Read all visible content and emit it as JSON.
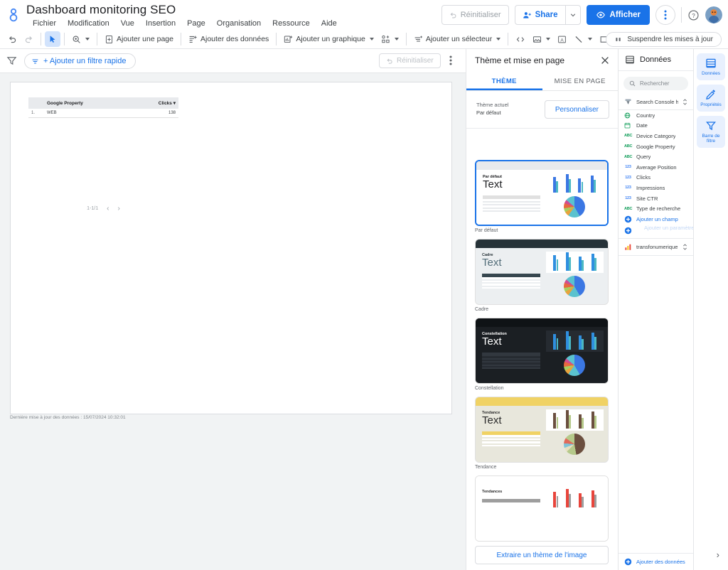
{
  "app": {
    "logo_icon": "looker-studio-logo",
    "title": "Dashboard monitoring SEO",
    "menu": [
      "Fichier",
      "Modification",
      "Vue",
      "Insertion",
      "Page",
      "Organisation",
      "Ressource",
      "Aide"
    ]
  },
  "topbar_actions": {
    "reset_label": "Réinitialiser",
    "reset_icon": "undo-icon",
    "share_label": "Share",
    "share_icon": "person-add-icon",
    "share_caret_icon": "chevron-down-icon",
    "view_label": "Afficher",
    "view_icon": "eye-icon",
    "kebab_icon": "more-vert-icon",
    "help_icon": "help-circle-icon",
    "avatar_icon": "user-avatar"
  },
  "toolbar": {
    "undo_icon": "undo-icon",
    "redo_icon": "redo-icon",
    "select_icon": "cursor-arrow-icon",
    "zoom_icon": "magnifier-icon",
    "add_page_label": "Ajouter une page",
    "add_page_icon": "page-add-icon",
    "add_data_label": "Ajouter des données",
    "add_data_icon": "data-add-icon",
    "add_chart_label": "Ajouter un graphique",
    "add_chart_icon": "chart-add-icon",
    "community_icon": "community-viz-icon",
    "add_control_label": "Ajouter un sélecteur",
    "add_control_icon": "control-add-icon",
    "embed_icon": "code-embed-icon",
    "image_icon": "image-icon",
    "text_icon": "text-box-icon",
    "line_icon": "line-icon",
    "shape_icon": "rectangle-icon",
    "more_icon": "more-vert-icon",
    "pause_label": "Suspendre les mises à jour",
    "pause_icon": "pause-icon"
  },
  "filterbar": {
    "filter_icon": "filter-funnel-icon",
    "add_filter_label": "+ Ajouter un filtre rapide",
    "add_filter_icon": "filter-small-icon",
    "reset_label": "Réinitialiser",
    "reset_icon": "undo-icon",
    "kebab_icon": "more-vert-icon"
  },
  "canvas": {
    "table": {
      "columns": [
        "",
        "Google Property",
        "Clicks"
      ],
      "sort_caret_icon": "sort-desc-icon",
      "rows": [
        {
          "index": "1.",
          "property": "WEB",
          "clicks": "138"
        }
      ]
    },
    "pager": {
      "range": "1-1/1",
      "prev_icon": "chevron-left-icon",
      "next_icon": "chevron-right-icon"
    },
    "last_update": "Dernière mise à jour des données : 15/07/2024 10:32:01"
  },
  "theme_panel": {
    "title": "Thème et mise en page",
    "close_icon": "close-icon",
    "tabs": [
      {
        "label": "THÈME",
        "active": true
      },
      {
        "label": "MISE EN PAGE",
        "active": false
      }
    ],
    "current_label": "Thème actuel",
    "current_value": "Par défaut",
    "customize_label": "Personnaliser",
    "extract_label": "Extraire un thème de l'image",
    "themes": [
      {
        "name": "Par défaut",
        "kicker": "Par défaut",
        "sample_text": "Text",
        "selected": true,
        "bg": "#ffffff",
        "bar_color": "#e8eaed",
        "text_color": "#202124",
        "kicker_color": "#202124",
        "panel_bg": "#ffffff",
        "line_color": "#e8eaed",
        "hdr_color": "#e0e0e0",
        "bar_a": "#3b77e3",
        "bar_b": "#4bb8c4",
        "pie": "conic-gradient(#3b77e3 0deg 150deg, #5bc2ce 150deg 215deg, #e8a33d 215deg 240deg, #a6cf5f 240deg 262deg, #e8693f 262deg 290deg, #d14d8f 290deg 310deg, #5bc2ce 310deg 360deg)"
      },
      {
        "name": "Cadre",
        "kicker": "Cadre",
        "sample_text": "Text",
        "selected": false,
        "bg": "#eceff1",
        "bar_color": "#263238",
        "text_color": "#546e7a",
        "kicker_color": "#263238",
        "panel_bg": "#ffffff",
        "line_color": "#eceff1",
        "hdr_color": "#37474f",
        "bar_a": "#2f8fe0",
        "bar_b": "#4bb8c4",
        "pie": "conic-gradient(#3b77e3 0deg 150deg, #5bc2ce 150deg 215deg, #e8a33d 215deg 240deg, #a6cf5f 240deg 262deg, #e8693f 262deg 290deg, #d14d8f 290deg 310deg, #5bc2ce 310deg 360deg)"
      },
      {
        "name": "Constellation",
        "kicker": "Constellation",
        "sample_text": "Text",
        "selected": false,
        "bg": "#1b1f23",
        "bar_color": "#0f1316",
        "text_color": "#ffffff",
        "kicker_color": "#ffffff",
        "panel_bg": "#262b31",
        "line_color": "#32383f",
        "hdr_color": "#32383f",
        "bar_a": "#2f8fe0",
        "bar_b": "#4bb8c4",
        "pie": "conic-gradient(#3b77e3 0deg 150deg, #5bc2ce 150deg 215deg, #e8a33d 215deg 240deg, #a6cf5f 240deg 262deg, #e8693f 262deg 290deg, #d14d8f 290deg 310deg, #5bc2ce 310deg 360deg)"
      },
      {
        "name": "Tendance",
        "kicker": "Tendance",
        "sample_text": "Text",
        "selected": false,
        "bg": "#e8e7dc",
        "bar_color": "#f0d264",
        "text_color": "#2b2b2b",
        "kicker_color": "#2b2b2b",
        "panel_bg": "#ffffff",
        "line_color": "#e8e7dc",
        "hdr_color": "#f0d264",
        "bar_a": "#6b4f3f",
        "bar_b": "#b5c98a",
        "pie": "conic-gradient(#6b4f3f 0deg 170deg, #b5c98a 170deg 225deg, #e8e0c0 225deg 250deg, #7fc3d6 250deg 275deg, #e06a5a 275deg 305deg, #b5c98a 305deg 360deg)"
      },
      {
        "name": "Tendances",
        "kicker": "Tendances",
        "sample_text": "",
        "selected": false,
        "bg": "#ffffff",
        "bar_color": "#ffffff",
        "text_color": "#2b2b2b",
        "kicker_color": "#2b2b2b",
        "panel_bg": "#ffffff",
        "line_color": "#e8eaed",
        "hdr_color": "#9e9e9e",
        "bar_a": "#e8453c",
        "bar_b": "#9e9e9e",
        "pie": "conic-gradient(#e8453c 0deg 200deg, #9e9e9e 200deg 360deg)"
      }
    ]
  },
  "data_panel": {
    "title": "Données",
    "title_icon": "data-table-icon",
    "search_placeholder": "Rechercher",
    "search_icon": "search-icon",
    "source_name": "Search Console htt...",
    "source_icon": "search-console-icon",
    "source_expand_icon": "unfold-icon",
    "fields": [
      {
        "name": "Country",
        "type": "GEO",
        "type_icon": "globe-icon"
      },
      {
        "name": "Date",
        "type": "DATE",
        "type_icon": "calendar-icon"
      },
      {
        "name": "Device Category",
        "type": "ABC",
        "type_icon": "text-type-icon"
      },
      {
        "name": "Google Property",
        "type": "ABC",
        "type_icon": "text-type-icon"
      },
      {
        "name": "Query",
        "type": "ABC",
        "type_icon": "text-type-icon"
      },
      {
        "name": "Average Position",
        "type": "123",
        "type_icon": "number-type-icon"
      },
      {
        "name": "Clicks",
        "type": "123",
        "type_icon": "number-type-icon"
      },
      {
        "name": "Impressions",
        "type": "123",
        "type_icon": "number-type-icon"
      },
      {
        "name": "Site CTR",
        "type": "123",
        "type_icon": "number-type-icon"
      },
      {
        "name": "Type de recherche",
        "type": "ABC",
        "type_icon": "text-type-icon"
      }
    ],
    "add_field_label": "Ajouter un champ",
    "add_field_icon": "plus-circle-icon",
    "add_param_label": "Ajouter un paramètre",
    "add_param_icon": "plus-circle-icon",
    "dataset_name": "transfonumerique...",
    "dataset_icon": "bar-chart-icon",
    "dataset_expand_icon": "unfold-icon",
    "add_data_label": "Ajouter des données",
    "add_data_icon": "plus-circle-icon"
  },
  "rail": {
    "items": [
      {
        "label": "Données",
        "icon": "data-table-icon",
        "selected": true
      },
      {
        "label": "Propriétés",
        "icon": "pencil-icon",
        "selected": true
      },
      {
        "label": "Barre de filtre",
        "icon": "filter-funnel-icon",
        "selected": true
      }
    ],
    "collapse_icon": "chevron-right-icon"
  },
  "colors": {
    "accent": "#1a73e8",
    "accent_light": "#e8f0fe",
    "canvas_bg": "#f1f3f4",
    "border": "#dadce0",
    "text": "#202124",
    "text_muted": "#5f6368"
  }
}
